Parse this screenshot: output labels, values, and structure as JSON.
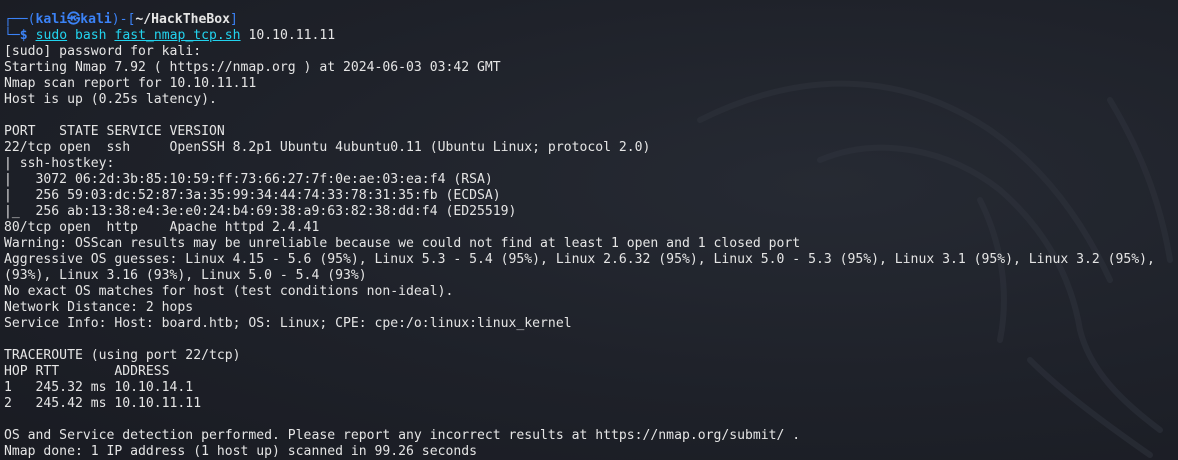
{
  "prompt": {
    "frame_top_left": "┌──(",
    "user": "kali",
    "at_symbol": "㉿",
    "host": "kali",
    "frame_mid": ")-[",
    "path": "~/HackTheBox",
    "frame_end": "]",
    "frame_bottom": "└─",
    "dollar": "$",
    "command_sudo": "sudo",
    "command_bash": "bash",
    "command_script": "fast_nmap_tcp.sh",
    "command_arg": "10.10.11.11"
  },
  "output": [
    "[sudo] password for kali:",
    "Starting Nmap 7.92 ( https://nmap.org ) at 2024-06-03 03:42 GMT",
    "Nmap scan report for 10.10.11.11",
    "Host is up (0.25s latency).",
    "",
    "PORT   STATE SERVICE VERSION",
    "22/tcp open  ssh     OpenSSH 8.2p1 Ubuntu 4ubuntu0.11 (Ubuntu Linux; protocol 2.0)",
    "| ssh-hostkey: ",
    "|   3072 06:2d:3b:85:10:59:ff:73:66:27:7f:0e:ae:03:ea:f4 (RSA)",
    "|   256 59:03:dc:52:87:3a:35:99:34:44:74:33:78:31:35:fb (ECDSA)",
    "|_  256 ab:13:38:e4:3e:e0:24:b4:69:38:a9:63:82:38:dd:f4 (ED25519)",
    "80/tcp open  http    Apache httpd 2.4.41",
    "Warning: OSScan results may be unreliable because we could not find at least 1 open and 1 closed port",
    "Aggressive OS guesses: Linux 4.15 - 5.6 (95%), Linux 5.3 - 5.4 (95%), Linux 2.6.32 (95%), Linux 5.0 - 5.3 (95%), Linux 3.1 (95%), Linux 3.2 (95%),",
    "(93%), Linux 3.16 (93%), Linux 5.0 - 5.4 (93%)",
    "No exact OS matches for host (test conditions non-ideal).",
    "Network Distance: 2 hops",
    "Service Info: Host: board.htb; OS: Linux; CPE: cpe:/o:linux:linux_kernel",
    "",
    "TRACEROUTE (using port 22/tcp)",
    "HOP RTT       ADDRESS",
    "1   245.32 ms 10.10.14.1",
    "2   245.42 ms 10.10.11.11",
    "",
    "OS and Service detection performed. Please report any incorrect results at https://nmap.org/submit/ .",
    "Nmap done: 1 IP address (1 host up) scanned in 99.26 seconds"
  ],
  "colors": {
    "background": "#1c1f27",
    "prompt_blue": "#3b82f6",
    "command_cyan": "#22d3ee",
    "text": "#e5e5e5"
  },
  "icons": {
    "background_logo": "kali-dragon-icon"
  }
}
